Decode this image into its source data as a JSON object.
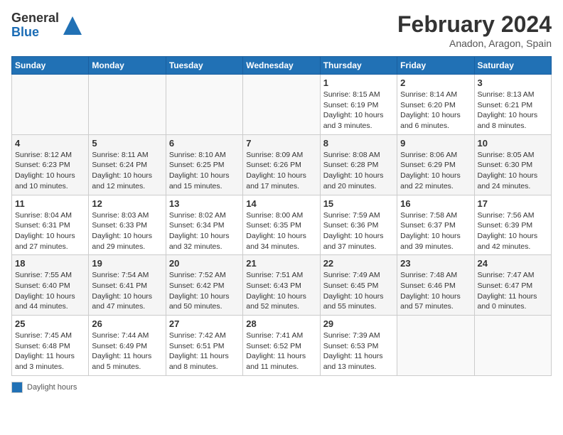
{
  "logo": {
    "general": "General",
    "blue": "Blue"
  },
  "title": "February 2024",
  "subtitle": "Anadon, Aragon, Spain",
  "days_of_week": [
    "Sunday",
    "Monday",
    "Tuesday",
    "Wednesday",
    "Thursday",
    "Friday",
    "Saturday"
  ],
  "legend_label": "Daylight hours",
  "weeks": [
    [
      {
        "day": "",
        "info": ""
      },
      {
        "day": "",
        "info": ""
      },
      {
        "day": "",
        "info": ""
      },
      {
        "day": "",
        "info": ""
      },
      {
        "day": "1",
        "info": "Sunrise: 8:15 AM\nSunset: 6:19 PM\nDaylight: 10 hours\nand 3 minutes."
      },
      {
        "day": "2",
        "info": "Sunrise: 8:14 AM\nSunset: 6:20 PM\nDaylight: 10 hours\nand 6 minutes."
      },
      {
        "day": "3",
        "info": "Sunrise: 8:13 AM\nSunset: 6:21 PM\nDaylight: 10 hours\nand 8 minutes."
      }
    ],
    [
      {
        "day": "4",
        "info": "Sunrise: 8:12 AM\nSunset: 6:23 PM\nDaylight: 10 hours\nand 10 minutes."
      },
      {
        "day": "5",
        "info": "Sunrise: 8:11 AM\nSunset: 6:24 PM\nDaylight: 10 hours\nand 12 minutes."
      },
      {
        "day": "6",
        "info": "Sunrise: 8:10 AM\nSunset: 6:25 PM\nDaylight: 10 hours\nand 15 minutes."
      },
      {
        "day": "7",
        "info": "Sunrise: 8:09 AM\nSunset: 6:26 PM\nDaylight: 10 hours\nand 17 minutes."
      },
      {
        "day": "8",
        "info": "Sunrise: 8:08 AM\nSunset: 6:28 PM\nDaylight: 10 hours\nand 20 minutes."
      },
      {
        "day": "9",
        "info": "Sunrise: 8:06 AM\nSunset: 6:29 PM\nDaylight: 10 hours\nand 22 minutes."
      },
      {
        "day": "10",
        "info": "Sunrise: 8:05 AM\nSunset: 6:30 PM\nDaylight: 10 hours\nand 24 minutes."
      }
    ],
    [
      {
        "day": "11",
        "info": "Sunrise: 8:04 AM\nSunset: 6:31 PM\nDaylight: 10 hours\nand 27 minutes."
      },
      {
        "day": "12",
        "info": "Sunrise: 8:03 AM\nSunset: 6:33 PM\nDaylight: 10 hours\nand 29 minutes."
      },
      {
        "day": "13",
        "info": "Sunrise: 8:02 AM\nSunset: 6:34 PM\nDaylight: 10 hours\nand 32 minutes."
      },
      {
        "day": "14",
        "info": "Sunrise: 8:00 AM\nSunset: 6:35 PM\nDaylight: 10 hours\nand 34 minutes."
      },
      {
        "day": "15",
        "info": "Sunrise: 7:59 AM\nSunset: 6:36 PM\nDaylight: 10 hours\nand 37 minutes."
      },
      {
        "day": "16",
        "info": "Sunrise: 7:58 AM\nSunset: 6:37 PM\nDaylight: 10 hours\nand 39 minutes."
      },
      {
        "day": "17",
        "info": "Sunrise: 7:56 AM\nSunset: 6:39 PM\nDaylight: 10 hours\nand 42 minutes."
      }
    ],
    [
      {
        "day": "18",
        "info": "Sunrise: 7:55 AM\nSunset: 6:40 PM\nDaylight: 10 hours\nand 44 minutes."
      },
      {
        "day": "19",
        "info": "Sunrise: 7:54 AM\nSunset: 6:41 PM\nDaylight: 10 hours\nand 47 minutes."
      },
      {
        "day": "20",
        "info": "Sunrise: 7:52 AM\nSunset: 6:42 PM\nDaylight: 10 hours\nand 50 minutes."
      },
      {
        "day": "21",
        "info": "Sunrise: 7:51 AM\nSunset: 6:43 PM\nDaylight: 10 hours\nand 52 minutes."
      },
      {
        "day": "22",
        "info": "Sunrise: 7:49 AM\nSunset: 6:45 PM\nDaylight: 10 hours\nand 55 minutes."
      },
      {
        "day": "23",
        "info": "Sunrise: 7:48 AM\nSunset: 6:46 PM\nDaylight: 10 hours\nand 57 minutes."
      },
      {
        "day": "24",
        "info": "Sunrise: 7:47 AM\nSunset: 6:47 PM\nDaylight: 11 hours\nand 0 minutes."
      }
    ],
    [
      {
        "day": "25",
        "info": "Sunrise: 7:45 AM\nSunset: 6:48 PM\nDaylight: 11 hours\nand 3 minutes."
      },
      {
        "day": "26",
        "info": "Sunrise: 7:44 AM\nSunset: 6:49 PM\nDaylight: 11 hours\nand 5 minutes."
      },
      {
        "day": "27",
        "info": "Sunrise: 7:42 AM\nSunset: 6:51 PM\nDaylight: 11 hours\nand 8 minutes."
      },
      {
        "day": "28",
        "info": "Sunrise: 7:41 AM\nSunset: 6:52 PM\nDaylight: 11 hours\nand 11 minutes."
      },
      {
        "day": "29",
        "info": "Sunrise: 7:39 AM\nSunset: 6:53 PM\nDaylight: 11 hours\nand 13 minutes."
      },
      {
        "day": "",
        "info": ""
      },
      {
        "day": "",
        "info": ""
      }
    ]
  ]
}
